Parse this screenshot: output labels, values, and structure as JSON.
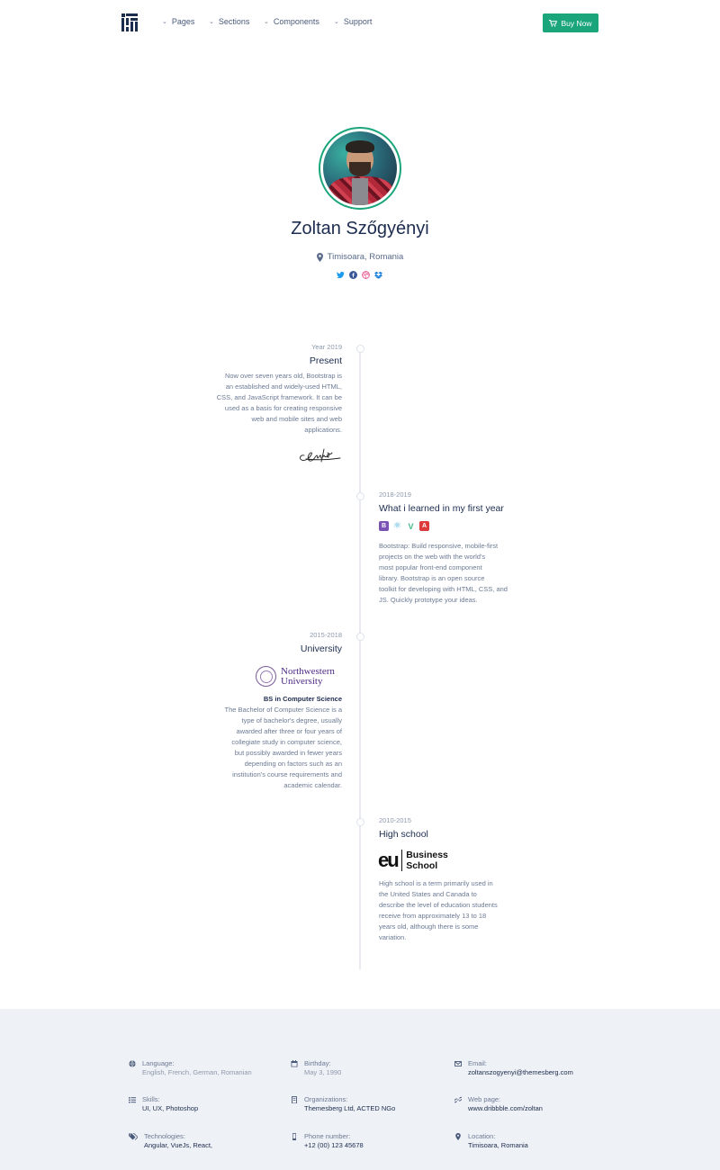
{
  "nav": {
    "items": [
      "Pages",
      "Sections",
      "Components",
      "Support"
    ],
    "buy_label": "Buy Now"
  },
  "profile": {
    "name": "Zoltan Szőgyényi",
    "location": "Timisoara, Romania",
    "socials": [
      "twitter-icon",
      "facebook-icon",
      "dribbble-icon",
      "dropbox-icon"
    ]
  },
  "timeline": [
    {
      "year": "Year 2019",
      "title": "Present",
      "desc": [
        "Now over seven years old, Bootstrap is",
        "an established and widely-used HTML,",
        "CSS, and JavaScript framework. It can be",
        "used as a basis for creating responsive",
        "web and mobile sites and web",
        "applications."
      ]
    },
    {
      "year": "2018-2019",
      "title": "What i learned in my first year",
      "tech_icons": [
        {
          "icon": "bootstrap-icon",
          "glyph": "B",
          "color": "#7952b3"
        },
        {
          "icon": "react-icon",
          "glyph": "⚛",
          "color": "#61dafb"
        },
        {
          "icon": "vue-icon",
          "glyph": "V",
          "color": "#41b883"
        },
        {
          "icon": "angular-icon",
          "glyph": "A",
          "color": "#dd3b3b"
        }
      ],
      "desc": [
        "Bootstrap: Build responsive, mobile-first",
        "projects on the web with the world's",
        "most popular front-end component",
        "library. Bootstrap is an open source",
        "toolkit for developing with HTML, CSS, and",
        "JS. Quickly prototype your ideas."
      ]
    },
    {
      "year": "2015-2018",
      "title": "University",
      "logo_lines": [
        "Northwestern",
        "University"
      ],
      "degree": "BS in Computer Science",
      "desc": [
        "The Bachelor of Computer Science is a",
        "type of bachelor's degree, usually",
        "awarded after three or four years of",
        "collegiate study in computer science,",
        "but possibly awarded in fewer years",
        "depending on factors such as an",
        "institution's course requirements and",
        "academic calendar."
      ]
    },
    {
      "year": "2010-2015",
      "title": "High school",
      "logo_mark": "eu",
      "logo_lines": [
        "Business",
        "School"
      ],
      "desc": [
        "High school is a term primarily used in",
        "the United States and Canada to",
        "describe the level of education students",
        "receive from approximately 13 to 18",
        "years old, although there is some",
        "variation."
      ]
    }
  ],
  "footer": {
    "language_label": "Language:",
    "language_value": "English, French, German, Romanian",
    "birthday_label": "Birthday:",
    "birthday_value": "May 3, 1990",
    "email_label": "Email:",
    "email_value": "zoltanszogyenyi@themesberg.com",
    "skills_label": "Skills:",
    "skills_value": "UI, UX, Photoshop",
    "orgs_label": "Organizations:",
    "orgs_value": "Themesberg Ltd, ACTED NGo",
    "web_label": "Web page:",
    "web_value": "www.dribbble.com/zoltan",
    "tech_label": "Technologies:",
    "tech_value": "Angular, VueJs, React,",
    "phone_label": "Phone number:",
    "phone_value": "+12 (00) 123 45678",
    "loc_label": "Location:",
    "loc_value": "Timisoara, Romania"
  },
  "colors": {
    "accent": "#1aa57a",
    "navy": "#1c2c4f",
    "footer_bg": "#eef1f5"
  }
}
